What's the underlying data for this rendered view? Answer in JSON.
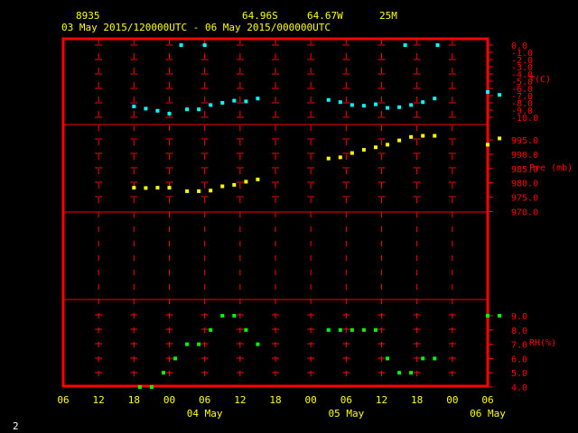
{
  "header": {
    "station": "8935",
    "lat": "64.96S",
    "lon": "64.67W",
    "elev": "25M",
    "range": "03 May 2015/120000UTC - 06 May 2015/000000UTC"
  },
  "page_number": "2",
  "colors": {
    "frame": "#ff0000",
    "grid": "#ff0000",
    "labels": "#ff0000",
    "header": "#ffff00",
    "temp": "#00ffff",
    "pres": "#ffff00",
    "rh": "#00ff00"
  },
  "chart_data": {
    "type": "scatter",
    "x_range_hours": [
      0,
      72
    ],
    "x_tick_labels": [
      "06",
      "12",
      "18",
      "00",
      "06",
      "12",
      "18",
      "00",
      "06",
      "12",
      "18",
      "00",
      "06"
    ],
    "date_labels": [
      {
        "label": "04 May",
        "hour": 36
      },
      {
        "label": "05 May",
        "hour": 60
      },
      {
        "label": "06 May",
        "hour": 84
      }
    ],
    "panels": [
      {
        "name": "T(C)",
        "color": "#00ffff",
        "ylim": [
          -10,
          0
        ],
        "ticks": [
          "0.0",
          "-1.0",
          "-2.0",
          "-3.0",
          "-4.0",
          "-5.0",
          "-6.0",
          "-7.0",
          "-8.0",
          "-9.0",
          "-10.0"
        ],
        "points": [
          [
            24,
            -8.5
          ],
          [
            26,
            -8.8
          ],
          [
            28,
            -9.1
          ],
          [
            30,
            -9.5
          ],
          [
            32,
            0
          ],
          [
            33,
            -8.9
          ],
          [
            35,
            -8.9
          ],
          [
            36,
            0
          ],
          [
            37,
            -8.3
          ],
          [
            39,
            -8
          ],
          [
            41,
            -7.7
          ],
          [
            43,
            -7.8
          ],
          [
            45,
            -7.4
          ],
          [
            57,
            -7.6
          ],
          [
            59,
            -7.9
          ],
          [
            61,
            -8.3
          ],
          [
            63,
            -8.4
          ],
          [
            65,
            -8.2
          ],
          [
            67,
            -8.7
          ],
          [
            69,
            -8.6
          ],
          [
            70,
            0
          ],
          [
            71,
            -8.3
          ],
          [
            73,
            -7.9
          ],
          [
            75,
            -7.4
          ],
          [
            75.5,
            0
          ],
          [
            84,
            -6.5
          ],
          [
            86,
            -6.9
          ]
        ]
      },
      {
        "name": "Pre (mb)",
        "color": "#ffff00",
        "ylim": [
          970,
          1000
        ],
        "ticks": [
          "995.0",
          "990.0",
          "985.0",
          "980.0",
          "975.0",
          "970.0"
        ],
        "ticks_values": [
          995,
          990,
          985,
          980,
          975,
          970
        ],
        "points": [
          [
            24,
            978.3
          ],
          [
            26,
            978.2
          ],
          [
            28,
            978.3
          ],
          [
            30,
            978.3
          ],
          [
            33,
            977.1
          ],
          [
            35,
            977.1
          ],
          [
            37,
            977.3
          ],
          [
            39,
            978.8
          ],
          [
            41,
            979.3
          ],
          [
            43,
            980.4
          ],
          [
            45,
            981.2
          ],
          [
            57,
            988.5
          ],
          [
            59,
            988.9
          ],
          [
            61,
            990.4
          ],
          [
            63,
            991.5
          ],
          [
            65,
            992.4
          ],
          [
            67,
            993.3
          ],
          [
            69,
            994.8
          ],
          [
            71,
            996
          ],
          [
            73,
            996.4
          ],
          [
            75,
            996.4
          ],
          [
            84,
            993.3
          ],
          [
            86,
            995.5
          ]
        ]
      },
      {
        "name": "RH(%)",
        "color": "#00ff00",
        "ylim": [
          4,
          9
        ],
        "ticks": [
          "9.0",
          "8.0",
          "7.0",
          "6.0",
          "5.0",
          "4.0"
        ],
        "ticks_values": [
          9,
          8,
          7,
          6,
          5,
          4
        ],
        "points": [
          [
            25,
            4
          ],
          [
            27,
            4
          ],
          [
            29,
            5
          ],
          [
            31,
            6
          ],
          [
            33,
            7
          ],
          [
            35,
            7
          ],
          [
            37,
            8
          ],
          [
            39,
            9
          ],
          [
            41,
            9
          ],
          [
            43,
            8
          ],
          [
            45,
            7
          ],
          [
            57,
            8
          ],
          [
            59,
            8
          ],
          [
            61,
            8
          ],
          [
            63,
            8
          ],
          [
            65,
            8
          ],
          [
            67,
            6
          ],
          [
            69,
            5
          ],
          [
            71,
            5
          ],
          [
            73,
            6
          ],
          [
            75,
            6
          ],
          [
            84,
            9
          ],
          [
            86,
            9
          ]
        ]
      }
    ]
  }
}
